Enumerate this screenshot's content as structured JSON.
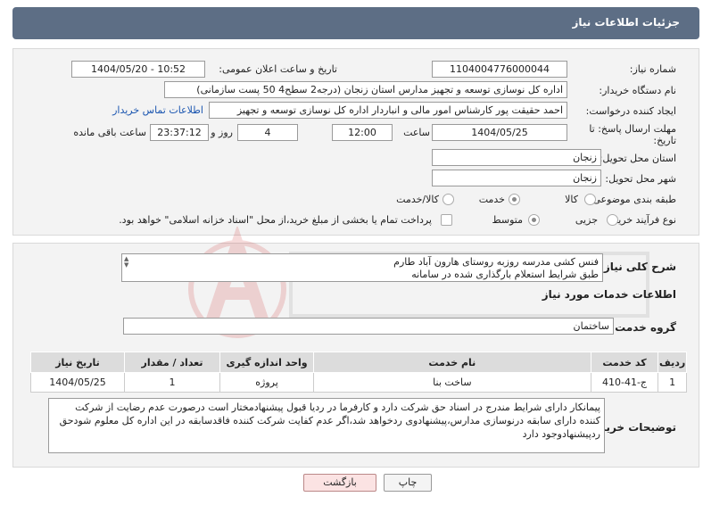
{
  "header": {
    "title": "جزئیات اطلاعات نیاز"
  },
  "fields": {
    "need_number_label": "شماره نیاز:",
    "need_number": "1104004776000044",
    "announce_label": "تاریخ و ساعت اعلان عمومی:",
    "announce_value": "1404/05/20 - 10:52",
    "buyer_label": "نام دستگاه خریدار:",
    "buyer_value": "اداره کل نوسازی   توسعه و تجهیز مدارس استان زنجان (درجه2  سطح4  50 پست سازمانی)",
    "creator_label": "ایجاد کننده درخواست:",
    "creator_value": "احمد حقیقت پور کارشناس امور مالی و انباردار اداره کل نوسازی   توسعه و تجهیز",
    "contact_link": "اطلاعات تماس خریدار",
    "deadline_label_1": "مهلت ارسال پاسخ: تا",
    "deadline_label_2": "تاریخ:",
    "deadline_date": "1404/05/25",
    "time_label": "ساعت",
    "deadline_time": "12:00",
    "days_value": "4",
    "days_label": "روز و",
    "remaining_time": "23:37:12",
    "remaining_label": "ساعت باقی مانده",
    "province_label": "استان محل تحویل:",
    "province_value": "زنجان",
    "city_label": "شهر محل تحویل:",
    "city_value": "زنجان",
    "category_label": "طبقه بندی موضوعی:",
    "category_options": [
      "کالا",
      "خدمت",
      "کالا/خدمت"
    ],
    "process_label": "نوع فرآیند خرید :",
    "process_options": [
      "جزیی",
      "متوسط"
    ],
    "payment_note": "پرداخت تمام یا بخشی از مبلغ خرید،از محل \"اسناد خزانه اسلامی\" خواهد بود."
  },
  "description": {
    "label": "شرح کلی نیاز:",
    "line1": "فنس کشی مدرسه روزبه روستای هارون آباد طارم",
    "line2": "طبق شرایط استعلام بارگذاری شده در سامانه"
  },
  "services": {
    "section_title": "اطلاعات خدمات مورد نیاز",
    "group_label": "گروه خدمت:",
    "group_value": "ساختمان",
    "columns": [
      "ردیف",
      "کد خدمت",
      "نام خدمت",
      "واحد اندازه گیری",
      "تعداد / مقدار",
      "تاریخ نیاز"
    ],
    "rows": [
      [
        "1",
        "ج-41-410",
        "ساخت بنا",
        "پروژه",
        "1",
        "1404/05/25"
      ]
    ]
  },
  "notes": {
    "label": "توضیحات خریدار:",
    "text": "پیمانکار دارای شرایط مندرج در اسناد حق شرکت دارد و کارفرما در ردیا قبول پیشنهادمختار است درصورت عدم رضایت از شرکت کننده دارای سابقه درنوسازی مدارس،پیشنهادوی ردخواهد شد،اگر عدم کفایت شرکت کننده فاقدسابقه در این اداره کل معلوم شودحق ردپیشنهادوجود دارد"
  },
  "buttons": {
    "print": "چاپ",
    "back": "بازگشت"
  },
  "colors": {
    "header": "#5d6e85",
    "link": "#1a55b0",
    "back_button": "#fbe3e3"
  }
}
